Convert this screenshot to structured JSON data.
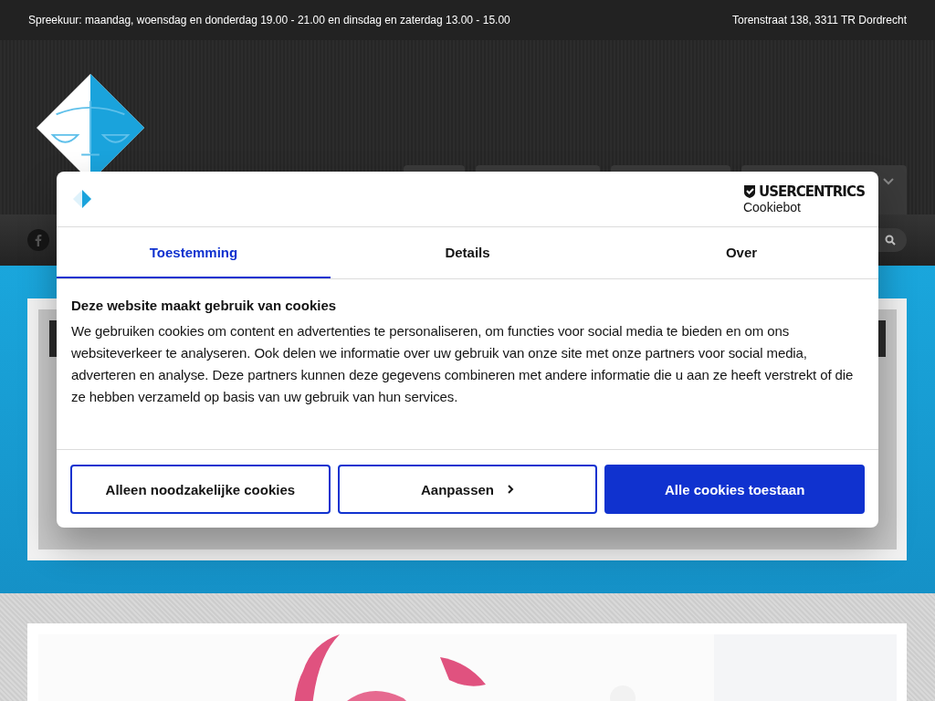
{
  "top_bar": {
    "hours": "Spreekuur: maandag, woensdag en donderdag 19.00 - 21.00 en dinsdag en zaterdag 13.00 - 15.00",
    "address": "Torenstraat 138, 3311 TR Dordrecht"
  },
  "consent_dialog": {
    "brand": "USERCENTRICS",
    "product": "Cookiebot",
    "tabs": [
      {
        "label": "Toestemming",
        "selected": true
      },
      {
        "label": "Details",
        "selected": false
      },
      {
        "label": "Over",
        "selected": false
      }
    ],
    "heading": "Deze website maakt gebruik van cookies",
    "body": "We gebruiken cookies om content en advertenties te personaliseren, om functies voor social media te bieden en om ons websiteverkeer te analyseren. Ook delen we informatie over uw gebruik van onze site met onze partners voor social media, adverteren en analyse. Deze partners kunnen deze gegevens combineren met andere informatie die u aan ze heeft verstrekt of die ze hebben verzameld op basis van uw gebruik van hun services.",
    "buttons": [
      {
        "label": "Alleen noodzakelijke cookies",
        "kind": "outline"
      },
      {
        "label": "Aanpassen",
        "kind": "outline-chevron"
      },
      {
        "label": "Alle cookies toestaan",
        "kind": "primary"
      }
    ]
  }
}
